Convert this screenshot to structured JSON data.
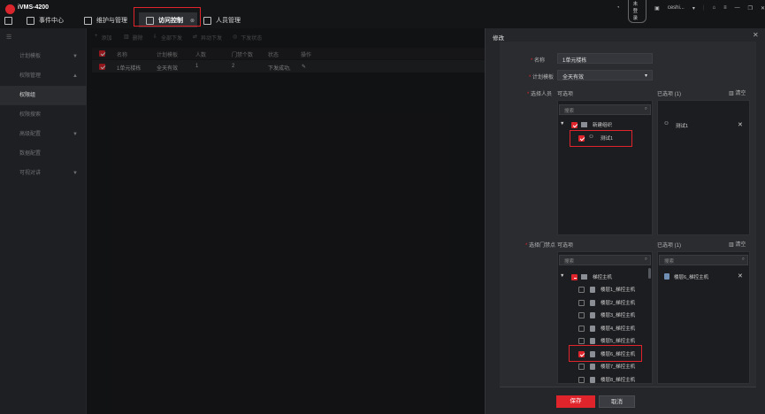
{
  "app": {
    "title": "iVMS-4200"
  },
  "nav": [
    {
      "label": "事件中心",
      "icon": "event-center-icon"
    },
    {
      "label": "维护与管理",
      "icon": "maintenance-icon"
    },
    {
      "label": "访问控制",
      "icon": "access-control-icon"
    },
    {
      "label": "人员管理",
      "icon": "person-management-icon"
    }
  ],
  "topright": {
    "cloud": "未登录",
    "user": "ceshi..."
  },
  "sidebar": [
    {
      "label": "计划模板",
      "chev": "▼"
    },
    {
      "label": "权限管理",
      "chev": "▲"
    },
    {
      "label": "权限组",
      "chev": ""
    },
    {
      "label": "权限搜索",
      "chev": ""
    },
    {
      "label": "高级配置",
      "chev": "▼"
    },
    {
      "label": "数据配置",
      "chev": ""
    },
    {
      "label": "可视对讲",
      "chev": "▼"
    }
  ],
  "toolbar": {
    "add": "添加",
    "delete": "删除",
    "apply_all": "全部下发",
    "apply_changed": "异动下发",
    "apply_status": "下发状态"
  },
  "table": {
    "headers": [
      "名称",
      "计划模板",
      "人数",
      "门禁个数",
      "状态",
      "操作"
    ],
    "rows": [
      {
        "name": "1单元楼栋",
        "template": "全天有效",
        "people": "1",
        "doors": "2",
        "status": "下发成功,"
      }
    ]
  },
  "dialog": {
    "title": "修改",
    "name_label": "名称",
    "name_value": "1单元楼栋",
    "template_label": "计划模板",
    "template_value": "全天有效",
    "select_person_label": "选择人员",
    "available": "可选项",
    "selected": "已选项 (1)",
    "clear": "清空",
    "search_placeholder": "搜索",
    "person_tree": {
      "org": "新建组织",
      "person": "测试1"
    },
    "selected_persons": [
      "测试1"
    ],
    "select_door_label": "选择门禁点",
    "door_tree_root": "梯控主机",
    "doors": [
      {
        "label": "楼层1_梯控主机",
        "checked": false
      },
      {
        "label": "楼层2_梯控主机",
        "checked": false
      },
      {
        "label": "楼层3_梯控主机",
        "checked": false
      },
      {
        "label": "楼层4_梯控主机",
        "checked": false
      },
      {
        "label": "楼层5_梯控主机",
        "checked": false
      },
      {
        "label": "楼层6_梯控主机",
        "checked": true
      },
      {
        "label": "楼层7_梯控主机",
        "checked": false
      },
      {
        "label": "楼层8_梯控主机",
        "checked": false
      }
    ],
    "selected_doors": [
      "楼层6_梯控主机"
    ],
    "save": "保存",
    "cancel": "取消"
  },
  "colors": {
    "accent": "#e0242b",
    "background": "#1b1c1f",
    "dialog": "#24262a"
  }
}
